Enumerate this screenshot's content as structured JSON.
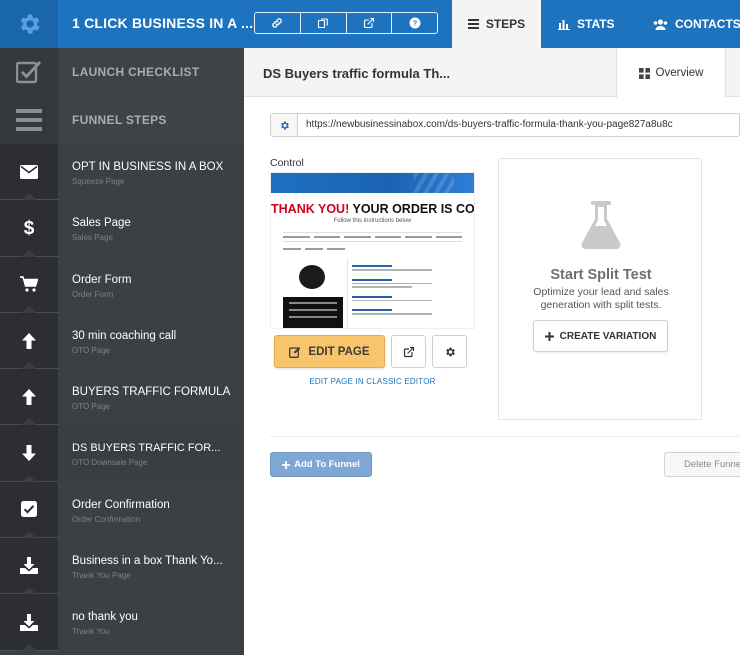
{
  "topbar": {
    "funnel_title": "1 CLICK BUSINESS IN A ...",
    "tools": [
      "link-icon",
      "copy-icon",
      "external-link-icon",
      "help-icon"
    ],
    "tabs": [
      {
        "label": "STEPS",
        "icon": "list-icon",
        "active": true
      },
      {
        "label": "STATS",
        "icon": "bar-chart-icon",
        "active": false
      },
      {
        "label": "CONTACTS",
        "icon": "users-icon",
        "active": false
      }
    ],
    "colors": {
      "bar": "#1e73be",
      "active_tab": "#f4f4f4"
    }
  },
  "sidebar": {
    "launch_checklist": "LAUNCH CHECKLIST",
    "funnel_steps": "FUNNEL STEPS",
    "steps": [
      {
        "name": "OPT IN BUSINESS IN A BOX",
        "type": "Squeeze Page",
        "icon": "envelope-icon"
      },
      {
        "name": "Sales Page",
        "type": "Sales Page",
        "icon": "dollar-icon"
      },
      {
        "name": "Order Form",
        "type": "Order Form",
        "icon": "cart-icon"
      },
      {
        "name": "30 min coaching call",
        "type": "OTO Page",
        "icon": "arrow-up-icon"
      },
      {
        "name": "BUYERS TRAFFIC FORMULA",
        "type": "OTO Page",
        "icon": "arrow-up-icon"
      },
      {
        "name": "DS BUYERS TRAFFIC FOR...",
        "type": "OTO Downsale Page",
        "icon": "arrow-down-icon"
      },
      {
        "name": "Order Confirmation",
        "type": "Order Confirmation",
        "icon": "checkbox-icon"
      },
      {
        "name": "Business in a box Thank Yo...",
        "type": "Thank You Page",
        "icon": "download-icon"
      },
      {
        "name": "no thank you",
        "type": "Thank You",
        "icon": "download-icon"
      }
    ]
  },
  "main": {
    "page_title": "DS Buyers traffic formula Th...",
    "overview_tab": "Overview",
    "url": "https://newbusinessinabox.com/ds-buyers-traffic-formula-thank-you-page827a8u8c",
    "control_label": "Control",
    "thumbnail": {
      "headline_red": "THANK YOU!",
      "headline_black": "YOUR ORDER IS COMPLETE!",
      "subline": "Follow this instructions below"
    },
    "edit_page_label": "EDIT PAGE",
    "classic_editor_link": "EDIT PAGE IN CLASSIC EDITOR",
    "split_test": {
      "title": "Start Split Test",
      "description": "Optimize your lead and sales generation with split tests.",
      "button": "CREATE VARIATION"
    },
    "add_to_funnel": "Add To Funnel",
    "delete_label": "Delete Funnel Step",
    "colors": {
      "edit_button": "#f9c56c",
      "add_button": "#7fa7d4",
      "link": "#1e73be"
    }
  }
}
